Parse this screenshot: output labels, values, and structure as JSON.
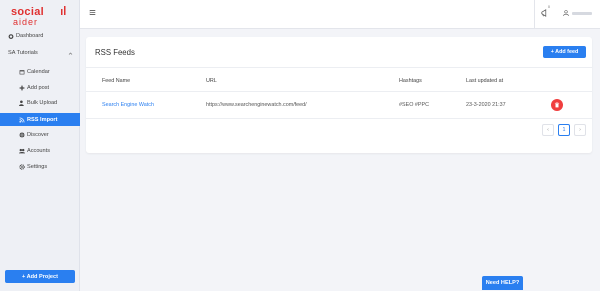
{
  "brand": {
    "line1": "social",
    "line2": "aider",
    "accent": "#e03131"
  },
  "sidebar": {
    "dashboard": "Dashboard",
    "group": "SA Tutorials",
    "items": [
      {
        "label": "Calendar",
        "icon": "calendar-icon"
      },
      {
        "label": "Add post",
        "icon": "plus-icon"
      },
      {
        "label": "Bulk Upload",
        "icon": "user-upload-icon"
      },
      {
        "label": "RSS Import",
        "icon": "rss-icon",
        "active": true
      },
      {
        "label": "Discover",
        "icon": "globe-icon"
      },
      {
        "label": "Accounts",
        "icon": "accounts-icon"
      },
      {
        "label": "Settings",
        "icon": "gear-icon"
      }
    ],
    "add_project": "+ Add Project"
  },
  "topbar": {
    "notification_count": "0"
  },
  "card": {
    "title": "RSS Feeds",
    "add_feed_label": "+ Add feed",
    "columns": [
      "Feed Name",
      "URL",
      "Hashtags",
      "Last updated at"
    ],
    "rows": [
      {
        "feed_name": "Search Engine Watch",
        "url": "https://www.searchenginewatch.com/feed/",
        "hashtags": "#SEO #PPC",
        "last_updated": "23-3-2020 21:37"
      }
    ],
    "pagination": {
      "prev": "‹",
      "current": "1",
      "next": "›"
    }
  },
  "help_label": "Need HELP?",
  "colors": {
    "primary": "#2a7ff0",
    "danger": "#f03e3e"
  }
}
